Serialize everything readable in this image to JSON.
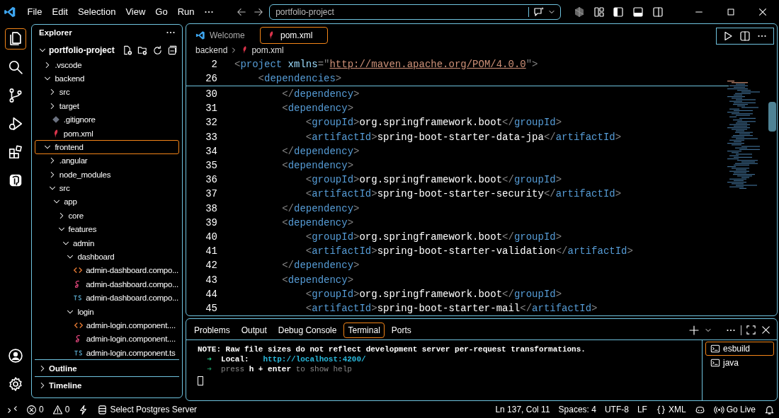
{
  "title_bar": {
    "menu": [
      "File",
      "Edit",
      "Selection",
      "View",
      "Go",
      "Run"
    ],
    "search": {
      "value": "portfolio-project"
    }
  },
  "activity_bar": {
    "items": [
      {
        "kind": "explorer",
        "selected": true
      },
      {
        "kind": "search",
        "selected": false
      },
      {
        "kind": "source-control",
        "selected": false
      },
      {
        "kind": "run-debug",
        "selected": false
      },
      {
        "kind": "extensions",
        "selected": false
      },
      {
        "kind": "database",
        "selected": false
      }
    ],
    "bottom": [
      {
        "kind": "account"
      },
      {
        "kind": "settings"
      }
    ]
  },
  "sidebar": {
    "title": "Explorer",
    "root": {
      "label": "portfolio-project",
      "expanded": true
    },
    "tree": [
      {
        "label": ".vscode",
        "kind": "folder",
        "expanded": false,
        "selected": false
      },
      {
        "label": "backend",
        "kind": "folder",
        "expanded": true,
        "selected": false,
        "children": [
          {
            "label": "src",
            "kind": "folder",
            "expanded": false,
            "selected": false
          },
          {
            "label": "target",
            "kind": "folder",
            "expanded": false,
            "selected": false
          },
          {
            "label": ".gitignore",
            "kind": "git",
            "selected": false
          },
          {
            "label": "pom.xml",
            "kind": "maven",
            "selected": false
          }
        ]
      },
      {
        "label": "frontend",
        "kind": "folder",
        "expanded": true,
        "selected": true,
        "children": [
          {
            "label": ".angular",
            "kind": "folder",
            "expanded": false,
            "selected": false
          },
          {
            "label": "node_modules",
            "kind": "folder",
            "expanded": false,
            "selected": false
          },
          {
            "label": "src",
            "kind": "folder",
            "expanded": true,
            "selected": false,
            "children": [
              {
                "label": "app",
                "kind": "folder",
                "expanded": true,
                "selected": false,
                "children": [
                  {
                    "label": "core",
                    "kind": "folder",
                    "expanded": false,
                    "selected": false
                  },
                  {
                    "label": "features",
                    "kind": "folder",
                    "expanded": true,
                    "selected": false,
                    "children": [
                      {
                        "label": "admin",
                        "kind": "folder",
                        "expanded": true,
                        "selected": false,
                        "children": [
                          {
                            "label": "dashboard",
                            "kind": "folder",
                            "expanded": true,
                            "selected": false,
                            "children": [
                              {
                                "label": "admin-dashboard.compo...",
                                "kind": "html",
                                "selected": false
                              },
                              {
                                "label": "admin-dashboard.compo...",
                                "kind": "scss",
                                "selected": false
                              },
                              {
                                "label": "admin-dashboard.compo...",
                                "kind": "ts",
                                "selected": false
                              }
                            ]
                          },
                          {
                            "label": "login",
                            "kind": "folder",
                            "expanded": true,
                            "selected": false,
                            "children": [
                              {
                                "label": "admin-login.component....",
                                "kind": "html",
                                "selected": false
                              },
                              {
                                "label": "admin-login.component....",
                                "kind": "scss",
                                "selected": false
                              },
                              {
                                "label": "admin-login.component.ts",
                                "kind": "ts",
                                "selected": false
                              }
                            ]
                          }
                        ]
                      }
                    ]
                  }
                ]
              }
            ]
          }
        ]
      }
    ],
    "sections": [
      {
        "label": "Outline",
        "expanded": false
      },
      {
        "label": "Timeline",
        "expanded": false
      }
    ]
  },
  "editor": {
    "tabs": [
      {
        "label": "Welcome",
        "kind": "vscode",
        "selected": false
      },
      {
        "label": "pom.xml",
        "kind": "maven",
        "selected": true
      }
    ],
    "breadcrumb": [
      {
        "label": "backend",
        "kind": "folder"
      },
      {
        "label": "pom.xml",
        "kind": "maven"
      }
    ],
    "sticky": [
      {
        "number": "2",
        "tokens": [
          {
            "kind": "punct",
            "text": "<"
          },
          {
            "kind": "tag",
            "text": "project"
          },
          {
            "kind": "attr",
            "text": " xmlns"
          },
          {
            "kind": "punct",
            "text": "=\""
          },
          {
            "kind": "link",
            "text": "http://maven.apache.org/POM/4.0.0"
          },
          {
            "kind": "punct",
            "text": "\""
          },
          {
            "kind": "punct",
            "text": ">"
          }
        ]
      },
      {
        "number": "26",
        "tokens": [
          {
            "kind": "punct",
            "text": "    <"
          },
          {
            "kind": "tag",
            "text": "dependencies"
          },
          {
            "kind": "punct",
            "text": ">"
          }
        ]
      }
    ],
    "lines": [
      {
        "number": "30",
        "tokens": [
          {
            "kind": "punct",
            "text": "        </"
          },
          {
            "kind": "tag",
            "text": "dependency"
          },
          {
            "kind": "punct",
            "text": ">"
          }
        ]
      },
      {
        "number": "31",
        "tokens": [
          {
            "kind": "punct",
            "text": "        <"
          },
          {
            "kind": "tag",
            "text": "dependency"
          },
          {
            "kind": "punct",
            "text": ">"
          }
        ]
      },
      {
        "number": "32",
        "tokens": [
          {
            "kind": "punct",
            "text": "            <"
          },
          {
            "kind": "tag",
            "text": "groupId"
          },
          {
            "kind": "punct",
            "text": ">"
          },
          {
            "kind": "text",
            "text": "org.springframework.boot"
          },
          {
            "kind": "punct",
            "text": "</"
          },
          {
            "kind": "tag",
            "text": "groupId"
          },
          {
            "kind": "punct",
            "text": ">"
          }
        ]
      },
      {
        "number": "33",
        "tokens": [
          {
            "kind": "punct",
            "text": "            <"
          },
          {
            "kind": "tag",
            "text": "artifactId"
          },
          {
            "kind": "punct",
            "text": ">"
          },
          {
            "kind": "text",
            "text": "spring-boot-starter-data-jpa"
          },
          {
            "kind": "punct",
            "text": "</"
          },
          {
            "kind": "tag",
            "text": "artifactId"
          },
          {
            "kind": "punct",
            "text": ">"
          }
        ]
      },
      {
        "number": "34",
        "tokens": [
          {
            "kind": "punct",
            "text": "        </"
          },
          {
            "kind": "tag",
            "text": "dependency"
          },
          {
            "kind": "punct",
            "text": ">"
          }
        ]
      },
      {
        "number": "35",
        "tokens": [
          {
            "kind": "punct",
            "text": "        <"
          },
          {
            "kind": "tag",
            "text": "dependency"
          },
          {
            "kind": "punct",
            "text": ">"
          }
        ]
      },
      {
        "number": "36",
        "tokens": [
          {
            "kind": "punct",
            "text": "            <"
          },
          {
            "kind": "tag",
            "text": "groupId"
          },
          {
            "kind": "punct",
            "text": ">"
          },
          {
            "kind": "text",
            "text": "org.springframework.boot"
          },
          {
            "kind": "punct",
            "text": "</"
          },
          {
            "kind": "tag",
            "text": "groupId"
          },
          {
            "kind": "punct",
            "text": ">"
          }
        ]
      },
      {
        "number": "37",
        "tokens": [
          {
            "kind": "punct",
            "text": "            <"
          },
          {
            "kind": "tag",
            "text": "artifactId"
          },
          {
            "kind": "punct",
            "text": ">"
          },
          {
            "kind": "text",
            "text": "spring-boot-starter-security"
          },
          {
            "kind": "punct",
            "text": "</"
          },
          {
            "kind": "tag",
            "text": "artifactId"
          },
          {
            "kind": "punct",
            "text": ">"
          }
        ]
      },
      {
        "number": "38",
        "tokens": [
          {
            "kind": "punct",
            "text": "        </"
          },
          {
            "kind": "tag",
            "text": "dependency"
          },
          {
            "kind": "punct",
            "text": ">"
          }
        ]
      },
      {
        "number": "39",
        "tokens": [
          {
            "kind": "punct",
            "text": "        <"
          },
          {
            "kind": "tag",
            "text": "dependency"
          },
          {
            "kind": "punct",
            "text": ">"
          }
        ]
      },
      {
        "number": "40",
        "tokens": [
          {
            "kind": "punct",
            "text": "            <"
          },
          {
            "kind": "tag",
            "text": "groupId"
          },
          {
            "kind": "punct",
            "text": ">"
          },
          {
            "kind": "text",
            "text": "org.springframework.boot"
          },
          {
            "kind": "punct",
            "text": "</"
          },
          {
            "kind": "tag",
            "text": "groupId"
          },
          {
            "kind": "punct",
            "text": ">"
          }
        ]
      },
      {
        "number": "41",
        "tokens": [
          {
            "kind": "punct",
            "text": "            <"
          },
          {
            "kind": "tag",
            "text": "artifactId"
          },
          {
            "kind": "punct",
            "text": ">"
          },
          {
            "kind": "text",
            "text": "spring-boot-starter-validation"
          },
          {
            "kind": "punct",
            "text": "</"
          },
          {
            "kind": "tag",
            "text": "artifactId"
          },
          {
            "kind": "punct",
            "text": ">"
          }
        ]
      },
      {
        "number": "42",
        "tokens": [
          {
            "kind": "punct",
            "text": "        </"
          },
          {
            "kind": "tag",
            "text": "dependency"
          },
          {
            "kind": "punct",
            "text": ">"
          }
        ]
      },
      {
        "number": "43",
        "tokens": [
          {
            "kind": "punct",
            "text": "        <"
          },
          {
            "kind": "tag",
            "text": "dependency"
          },
          {
            "kind": "punct",
            "text": ">"
          }
        ]
      },
      {
        "number": "44",
        "tokens": [
          {
            "kind": "punct",
            "text": "            <"
          },
          {
            "kind": "tag",
            "text": "groupId"
          },
          {
            "kind": "punct",
            "text": ">"
          },
          {
            "kind": "text",
            "text": "org.springframework.boot"
          },
          {
            "kind": "punct",
            "text": "</"
          },
          {
            "kind": "tag",
            "text": "groupId"
          },
          {
            "kind": "punct",
            "text": ">"
          }
        ]
      },
      {
        "number": "45",
        "tokens": [
          {
            "kind": "punct",
            "text": "            <"
          },
          {
            "kind": "tag",
            "text": "artifactId"
          },
          {
            "kind": "punct",
            "text": ">"
          },
          {
            "kind": "text",
            "text": "spring-boot-starter-mail"
          },
          {
            "kind": "punct",
            "text": "</"
          },
          {
            "kind": "tag",
            "text": "artifactId"
          },
          {
            "kind": "punct",
            "text": ">"
          }
        ]
      }
    ]
  },
  "panel": {
    "tabs": [
      {
        "label": "Problems",
        "selected": false
      },
      {
        "label": "Output",
        "selected": false
      },
      {
        "label": "Debug Console",
        "selected": false
      },
      {
        "label": "Terminal",
        "selected": true
      },
      {
        "label": "Ports",
        "selected": false
      }
    ],
    "terminal": {
      "lines": [
        [
          {
            "kind": "plain",
            "text": "NOTE: Raw file sizes do not reflect development server per-request transformations."
          }
        ],
        [
          {
            "kind": "arrow",
            "text": "  ➜  "
          },
          {
            "kind": "bold",
            "text": "Local:"
          },
          {
            "kind": "url",
            "text": "   http://localhost:4200/"
          }
        ],
        [
          {
            "kind": "arrow-dim",
            "text": "  ➜  "
          },
          {
            "kind": "dim",
            "text": "press "
          },
          {
            "kind": "bold",
            "text": "h + enter"
          },
          {
            "kind": "dim",
            "text": " to show help"
          }
        ]
      ],
      "cursor": true
    },
    "sessions": [
      {
        "label": "esbuild",
        "selected": true
      },
      {
        "label": "java",
        "selected": false
      }
    ]
  },
  "status_bar": {
    "left": [
      {
        "kind": "remote"
      },
      {
        "kind": "errors",
        "text": "0"
      },
      {
        "kind": "warnings",
        "text": "0"
      },
      {
        "kind": "bolt"
      },
      {
        "kind": "database",
        "text": "Select Postgres Server"
      }
    ],
    "right": [
      {
        "kind": "plain",
        "text": "Ln 137, Col 11"
      },
      {
        "kind": "plain",
        "text": "Spaces: 4"
      },
      {
        "kind": "plain",
        "text": "UTF-8"
      },
      {
        "kind": "plain",
        "text": "LF"
      },
      {
        "kind": "braces",
        "text": "XML"
      },
      {
        "kind": "copilot"
      },
      {
        "kind": "broadcast",
        "text": "Go Live"
      },
      {
        "kind": "bell"
      }
    ]
  }
}
